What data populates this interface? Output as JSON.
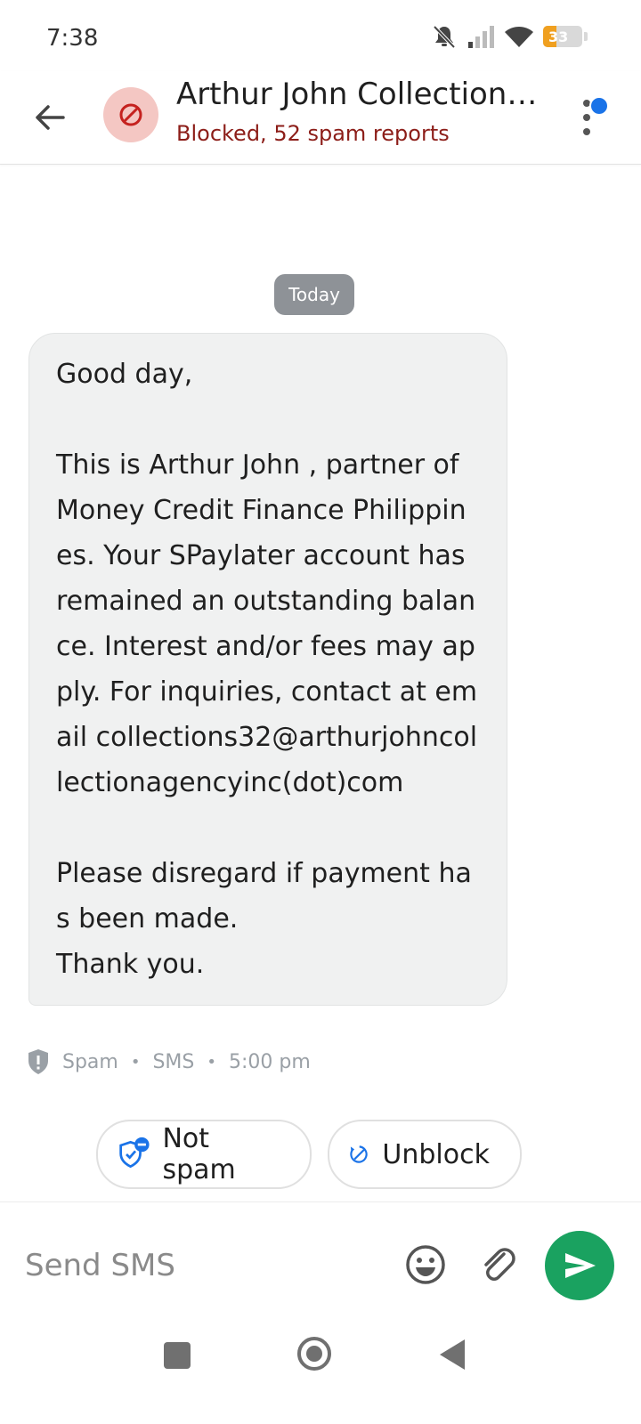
{
  "status_bar": {
    "time": "7:38",
    "battery": "33",
    "battery_level": 0.33
  },
  "header": {
    "contact_name": "Arthur John Collection A...",
    "subtitle": "Blocked, 52 spam reports",
    "icons": {
      "back": "arrow-back-icon",
      "avatar": "blocked-icon",
      "more": "more-vert-icon"
    }
  },
  "conversation": {
    "date_chip": "Today",
    "message": {
      "text": "Good day,\n\nThis is Arthur John , partner of Money Credit Finance Philippines. Your SPaylater account has remained an outstanding balance. Interest and/or fees may apply. For inquiries, contact at email collections32@arthurjohncollectionagencyinc(dot)com\n\nPlease disregard if payment has been made.\nThank you.",
      "label": "Spam",
      "type": "SMS",
      "time": "5:00 pm"
    },
    "actions": {
      "not_spam": "Not spam",
      "unblock": "Unblock"
    }
  },
  "composer": {
    "placeholder": "Send SMS"
  },
  "colors": {
    "accent_blue": "#1a73e8",
    "send_green": "#1aa260",
    "blocked_red": "#8c1d18",
    "avatar_bg": "#f4c7c3",
    "bubble_bg": "#f0f1f1",
    "date_chip_bg": "#8e9297",
    "battery_orange": "#f0a020"
  }
}
